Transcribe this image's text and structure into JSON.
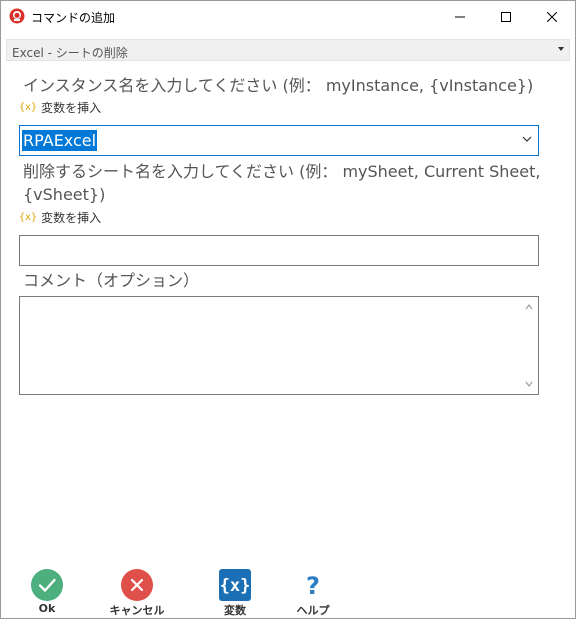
{
  "window": {
    "title": "コマンドの追加",
    "controls": {
      "minimize": "minimize-icon",
      "maximize": "maximize-icon",
      "close": "close-icon"
    }
  },
  "command_select": {
    "value": "Excel - シートの削除"
  },
  "fields": {
    "instance": {
      "label": "インスタンス名を入力してください (例： myInstance, {vInstance})",
      "insert_variable": "変数を挿入",
      "value": "RPAExcel"
    },
    "sheet": {
      "label_line1": "削除するシート名を入力してください (例： mySheet, Current Sheet,",
      "label_line2": "{vSheet})",
      "insert_variable": "変数を挿入",
      "value": ""
    },
    "comment": {
      "label": "コメント（オプション）",
      "value": ""
    }
  },
  "buttons": {
    "ok": "Ok",
    "cancel": "キャンセル",
    "variables": "変数",
    "help": "ヘルプ"
  },
  "colors": {
    "ok": "#4caf7d",
    "cancel": "#e0504a",
    "variables": "#1a6fb5",
    "help": "#2d7fc3",
    "selection": "#0078d7",
    "variable_icon": "#e0a100"
  }
}
